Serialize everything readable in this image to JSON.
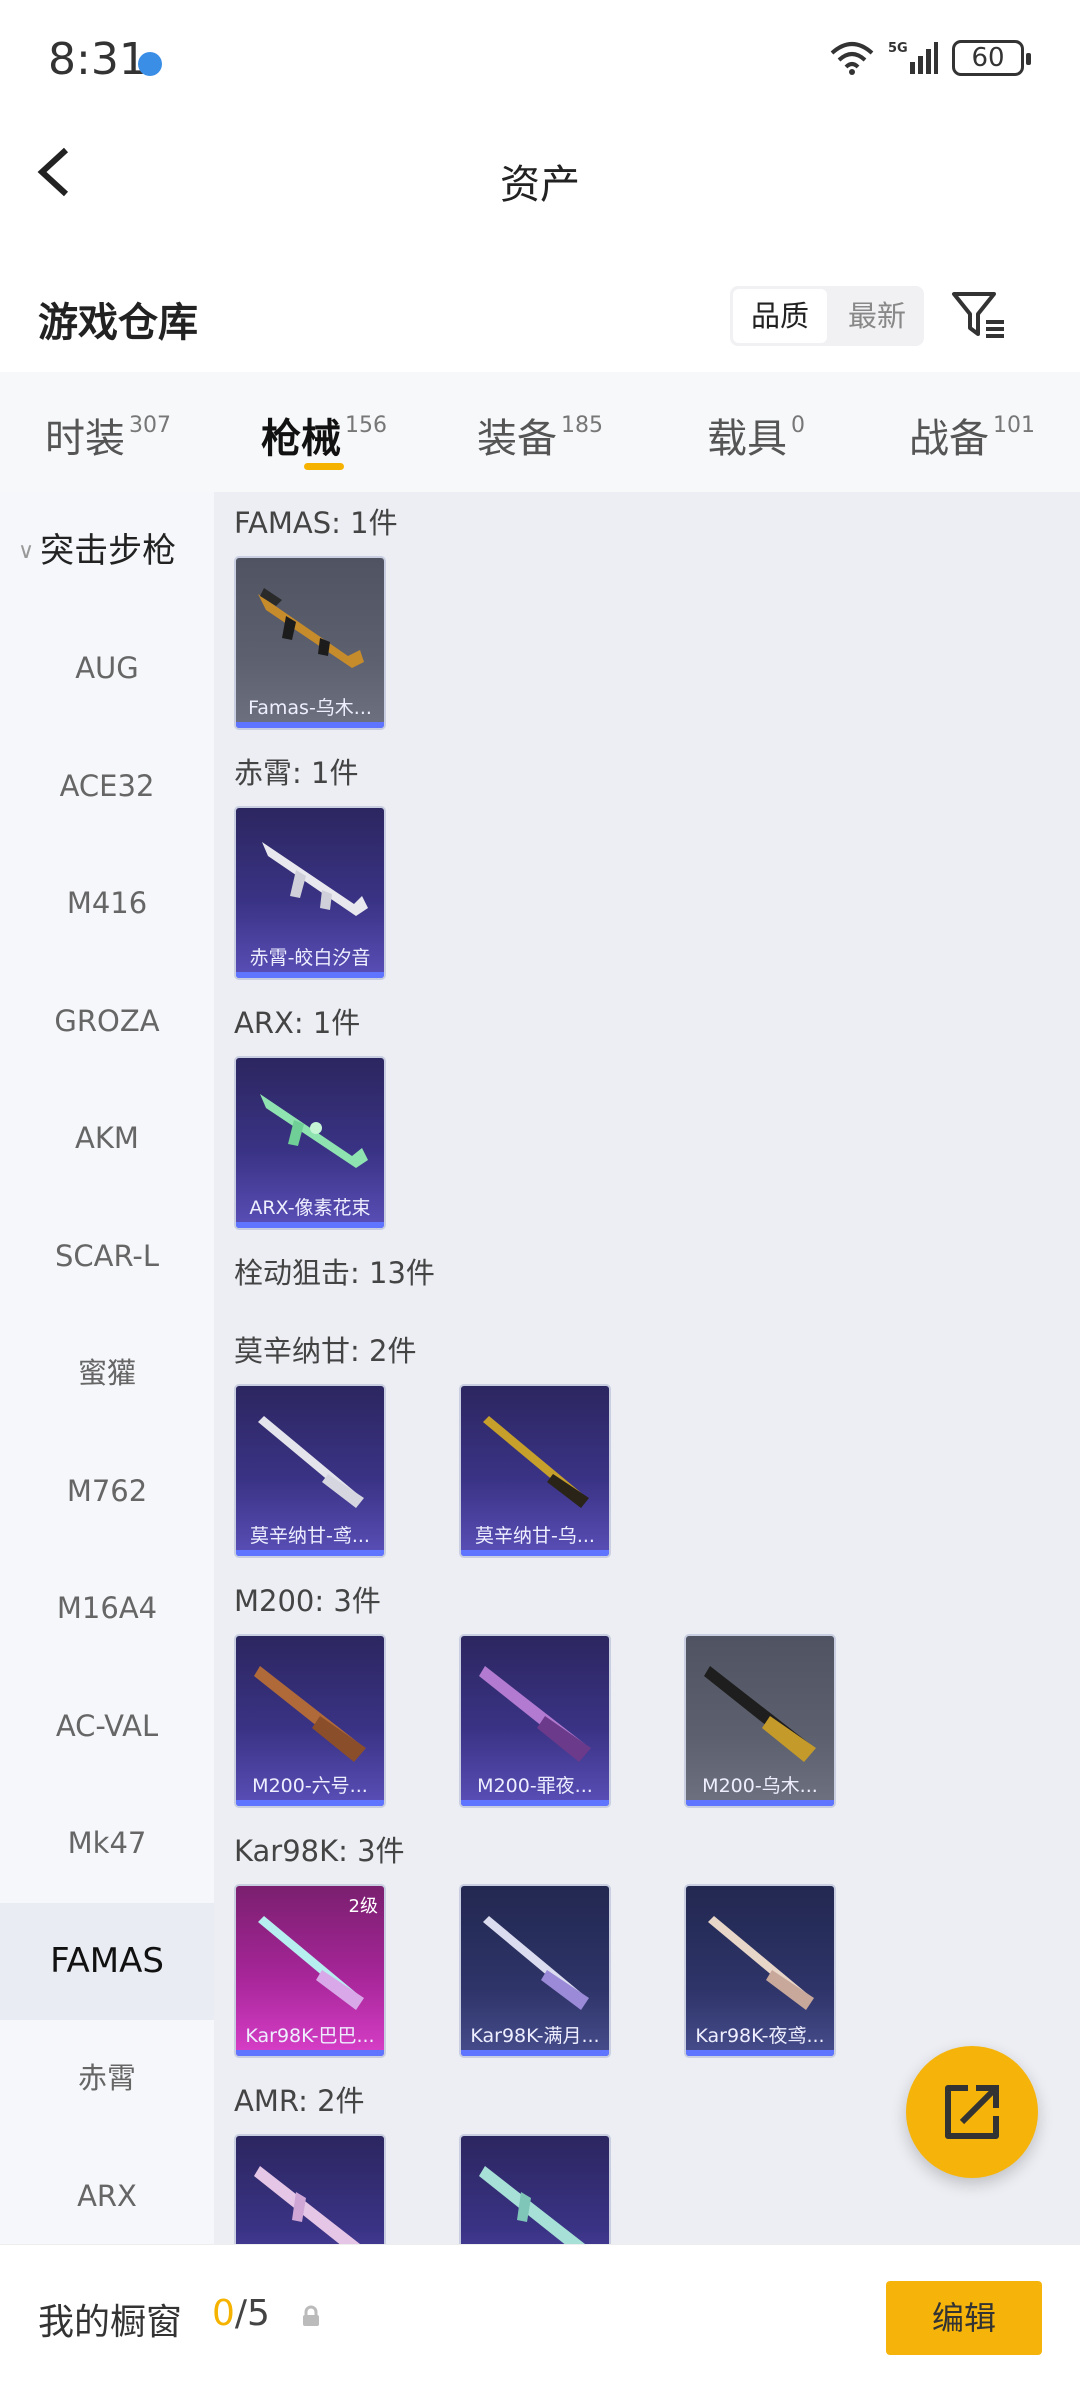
{
  "status": {
    "time": "8:31",
    "battery": "60"
  },
  "header": {
    "title": "资产"
  },
  "warehouse": {
    "label": "游戏仓库",
    "sort_quality": "品质",
    "sort_newest": "最新"
  },
  "tabs": [
    {
      "label": "时装",
      "count": "307"
    },
    {
      "label": "枪械",
      "count": "156"
    },
    {
      "label": "装备",
      "count": "185"
    },
    {
      "label": "载具",
      "count": "0"
    },
    {
      "label": "战备",
      "count": "101"
    }
  ],
  "sidebar": {
    "group": "突击步枪",
    "items": [
      "AUG",
      "ACE32",
      "M416",
      "GROZA",
      "AKM",
      "SCAR-L",
      "蜜獾",
      "M762",
      "M16A4",
      "AC-VAL",
      "Mk47",
      "FAMAS",
      "赤霄",
      "ARX"
    ]
  },
  "sections": [
    {
      "title": "FAMAS: 1件",
      "items": [
        "Famas-乌木..."
      ]
    },
    {
      "title": "赤霄: 1件",
      "items": [
        "赤霄-皎白汐音"
      ]
    },
    {
      "title": "ARX: 1件",
      "items": [
        "ARX-像素花束"
      ]
    },
    {
      "title": "栓动狙击: 13件",
      "items": []
    },
    {
      "title": "莫辛纳甘: 2件",
      "items": [
        "莫辛纳甘-鸢...",
        "莫辛纳甘-乌..."
      ]
    },
    {
      "title": "M200: 3件",
      "items": [
        "M200-六号...",
        "M200-罪夜...",
        "M200-乌木..."
      ]
    },
    {
      "title": "Kar98K: 3件",
      "items": [
        "Kar98K-巴巴...",
        "Kar98K-满月...",
        "Kar98K-夜鸢..."
      ]
    },
    {
      "title": "AMR: 2件",
      "items": [
        "",
        ""
      ]
    }
  ],
  "kar_level": "2级",
  "bottom": {
    "label": "我的橱窗",
    "count_zero": "0",
    "count_rest": "/5",
    "edit": "编辑"
  }
}
